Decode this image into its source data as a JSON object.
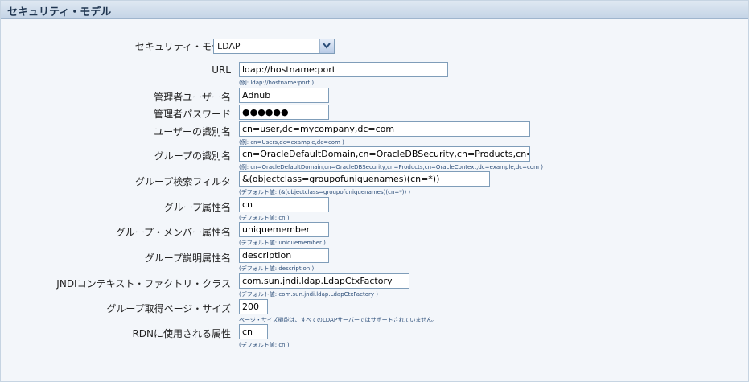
{
  "header": {
    "title": "セキュリティ・モデル"
  },
  "security_model": {
    "label": "セキュリティ・モデル",
    "selected": "LDAP"
  },
  "fields": [
    {
      "label": "URL",
      "value": "ldap://hostname:port",
      "hint": "(例: ldap://hostname:port )"
    },
    {
      "label": "管理者ユーザー名",
      "value": "Adnub",
      "hint": ""
    },
    {
      "label": "管理者パスワード",
      "value": "●●●●●●",
      "hint": ""
    },
    {
      "label": "ユーザーの識別名",
      "value": "cn=user,dc=mycompany,dc=com",
      "hint": "(例: cn=Users,dc=example,dc=com )"
    },
    {
      "label": "グループの識別名",
      "value": "cn=OracleDefaultDomain,cn=OracleDBSecurity,cn=Products,cn=OracleContext,dc=example,dc=com",
      "hint": "(例: cn=OracleDefaultDomain,cn=OracleDBSecurity,cn=Products,cn=OracleContext,dc=example,dc=com )"
    },
    {
      "label": "グループ検索フィルタ",
      "value": "&(objectclass=groupofuniquenames)(cn=*))",
      "hint": "(デフォルト値: (&(objectclass=groupofuniquenames)(cn=*)) )"
    },
    {
      "label": "グループ属性名",
      "value": "cn",
      "hint": "(デフォルト値: cn )"
    },
    {
      "label": "グループ・メンバー属性名",
      "value": "uniquemember",
      "hint": "(デフォルト値: uniquemember )"
    },
    {
      "label": "グループ説明属性名",
      "value": "description",
      "hint": "(デフォルト値: description )"
    },
    {
      "label": "JNDIコンテキスト・ファクトリ・クラス",
      "value": "com.sun.jndi.ldap.LdapCtxFactory",
      "hint": "(デフォルト値: com.sun.jndi.ldap.LdapCtxFactory )"
    },
    {
      "label": "グループ取得ページ・サイズ",
      "value": "200",
      "hint": "ページ・サイズ機能は、すべてのLDAPサーバーではサポートされていません。"
    },
    {
      "label": "RDNに使用される属性",
      "value": "cn",
      "hint": "(デフォルト値: cn )"
    }
  ]
}
